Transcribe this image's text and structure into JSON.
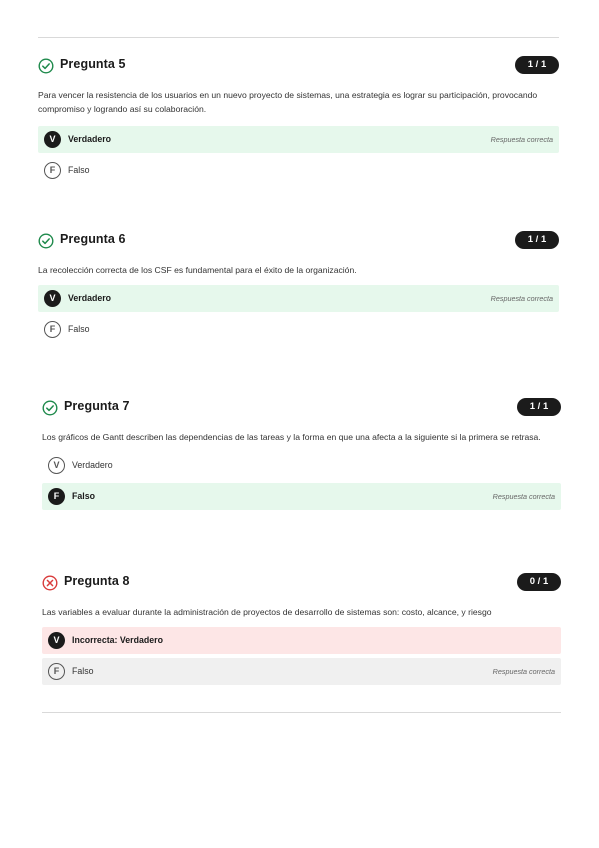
{
  "questions": [
    {
      "title": "Pregunta 5",
      "status": "correct",
      "score": "1 / 1",
      "text": "Para vencer la resistencia de los usuarios en un nuevo proyecto de sistemas, una estrategia es lograr su participación, provocando compromiso y logrando así su colaboración.",
      "options": [
        {
          "badge": "V",
          "label": "Verdadero",
          "style": "correct",
          "note": "Respuesta correcta"
        },
        {
          "badge": "F",
          "label": "Falso",
          "style": "plain",
          "note": ""
        }
      ]
    },
    {
      "title": "Pregunta 6",
      "status": "correct",
      "score": "1 / 1",
      "text": "La recolección correcta de los CSF es fundamental para el éxito de la organización.",
      "options": [
        {
          "badge": "V",
          "label": "Verdadero",
          "style": "correct",
          "note": "Respuesta correcta"
        },
        {
          "badge": "F",
          "label": "Falso",
          "style": "plain",
          "note": ""
        }
      ]
    },
    {
      "title": "Pregunta 7",
      "status": "correct",
      "score": "1 / 1",
      "text": "Los gráficos de Gantt describen las dependencias de las tareas y la forma en que una afecta a la siguiente si la primera se retrasa.",
      "options": [
        {
          "badge": "V",
          "label": "Verdadero",
          "style": "plain",
          "note": ""
        },
        {
          "badge": "F",
          "label": "Falso",
          "style": "correct",
          "note": "Respuesta correcta"
        }
      ]
    },
    {
      "title": "Pregunta 8",
      "status": "incorrect",
      "score": "0 / 1",
      "text": "Las variables a evaluar durante la administración de proyectos de desarrollo de sistemas son: costo, alcance, y riesgo",
      "options": [
        {
          "badge": "V",
          "label": "Incorrecta: Verdadero",
          "style": "wrong",
          "note": ""
        },
        {
          "badge": "F",
          "label": "Falso",
          "style": "neutral",
          "note": "Respuesta correcta"
        }
      ]
    }
  ],
  "colors": {
    "correct_icon": "#1f8a4c",
    "incorrect_icon": "#d93b3b",
    "correct_bg": "#e6f8ec",
    "wrong_bg": "#fde6e6",
    "neutral_bg": "#f0f0f0"
  },
  "icons": {
    "correct": "check-circle-icon",
    "incorrect": "x-circle-icon"
  }
}
